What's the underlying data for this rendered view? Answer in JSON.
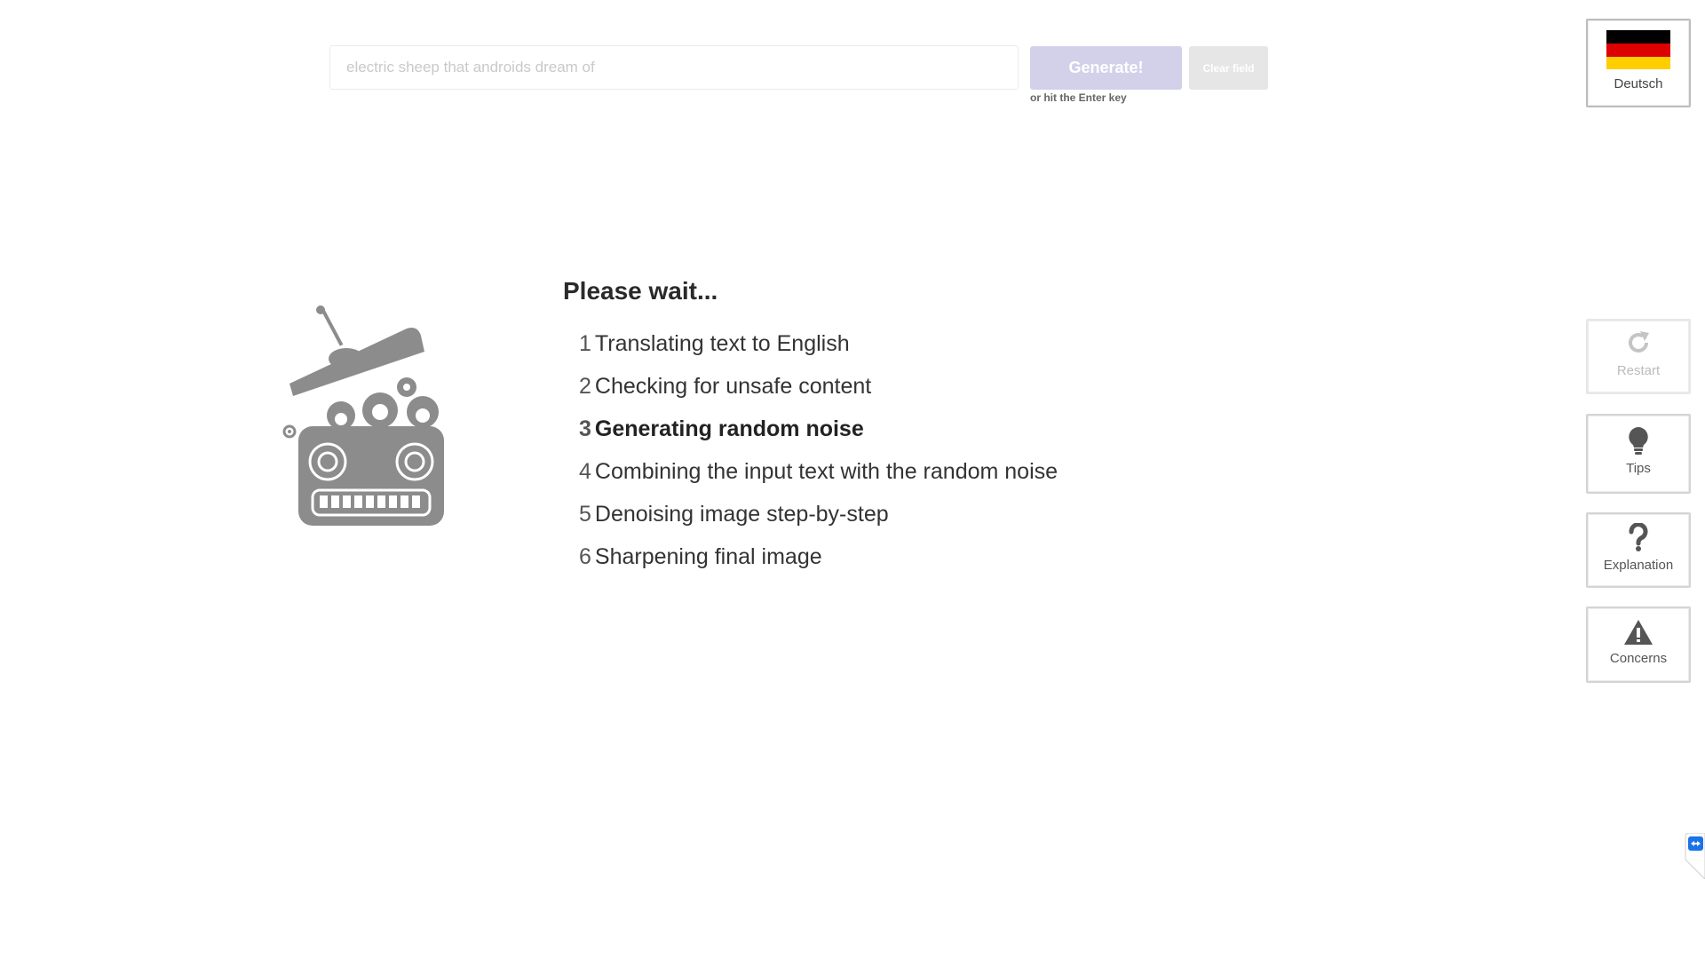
{
  "search": {
    "placeholder": "electric sheep that androids dream of",
    "value": ""
  },
  "buttons": {
    "generate_label": "Generate!",
    "clear_label": "Clear field",
    "enter_hint": "or hit the Enter key"
  },
  "progress": {
    "title": "Please wait...",
    "active_step": 3,
    "steps": [
      {
        "num": "1",
        "label": "Translating text to English"
      },
      {
        "num": "2",
        "label": "Checking for unsafe content"
      },
      {
        "num": "3",
        "label": "Generating random noise"
      },
      {
        "num": "4",
        "label": "Combining the input text with the random noise"
      },
      {
        "num": "5",
        "label": "Denoising image step-by-step"
      },
      {
        "num": "6",
        "label": "Sharpening final image"
      }
    ]
  },
  "sidebar": {
    "language": {
      "label": "Deutsch",
      "icon": "german-flag-icon"
    },
    "restart": {
      "label": "Restart",
      "icon": "restart-icon"
    },
    "tips": {
      "label": "Tips",
      "icon": "lightbulb-icon"
    },
    "explanation": {
      "label": "Explanation",
      "icon": "question-mark-icon"
    },
    "concerns": {
      "label": "Concerns",
      "icon": "warning-icon"
    }
  },
  "colors": {
    "generate_button": "#d3d0ea",
    "clear_button": "#e6e6e6",
    "robot": "#8c8c8c",
    "flag_black": "#000000",
    "flag_red": "#dd0000",
    "flag_gold": "#ffce00",
    "remote_tab": "#1a73e8"
  }
}
